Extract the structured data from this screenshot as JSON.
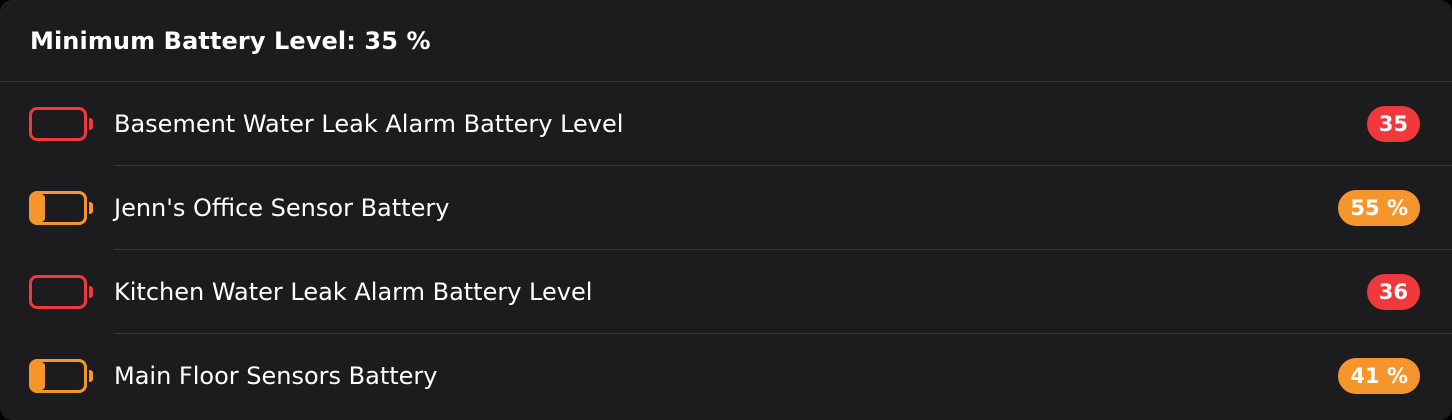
{
  "header": {
    "title": "Minimum Battery Level: 35 %"
  },
  "colors": {
    "critical": "#f1393b",
    "warning": "#f5962c",
    "background": "#1c1c1e",
    "separator": "#38383a"
  },
  "rows": [
    {
      "label": "Basement Water Leak Alarm Battery Level",
      "value": "35",
      "level": 0.0,
      "status": "critical",
      "icon": "battery-empty-icon"
    },
    {
      "label": "Jenn's Office Sensor Battery",
      "value": "55 %",
      "level": 0.25,
      "status": "warning",
      "icon": "battery-low-icon"
    },
    {
      "label": "Kitchen Water Leak Alarm Battery Level",
      "value": "36",
      "level": 0.0,
      "status": "critical",
      "icon": "battery-empty-icon"
    },
    {
      "label": "Main Floor Sensors Battery",
      "value": "41 %",
      "level": 0.25,
      "status": "warning",
      "icon": "battery-low-icon"
    }
  ]
}
